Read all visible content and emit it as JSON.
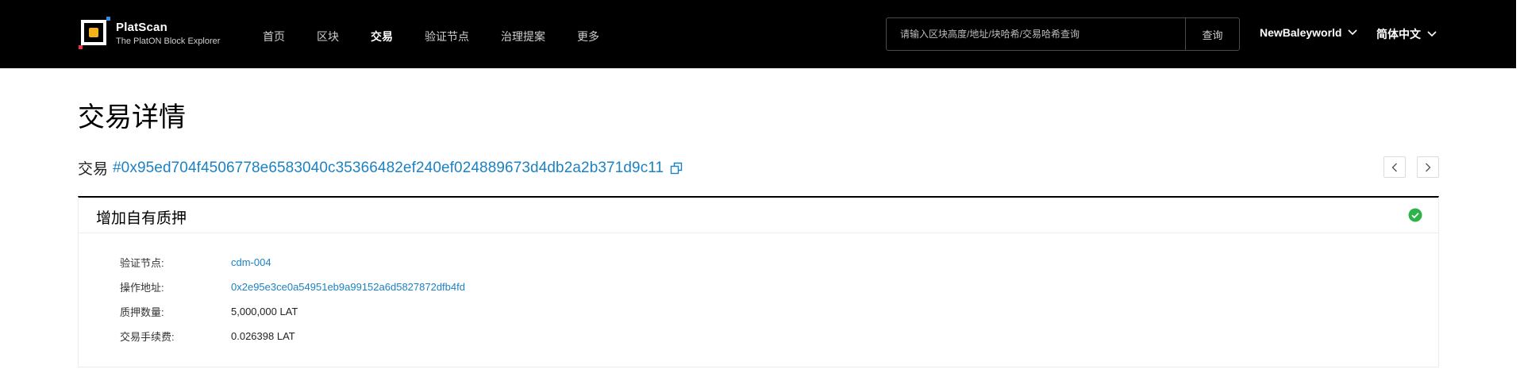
{
  "header": {
    "brand_name": "PlatScan",
    "brand_subtitle": "The PlatON Block Explorer",
    "nav": [
      {
        "label": "首页",
        "active": false
      },
      {
        "label": "区块",
        "active": false
      },
      {
        "label": "交易",
        "active": true
      },
      {
        "label": "验证节点",
        "active": false
      },
      {
        "label": "治理提案",
        "active": false
      },
      {
        "label": "更多",
        "active": false
      }
    ],
    "search": {
      "placeholder": "请输入区块高度/地址/块哈希/交易哈希查询",
      "button_label": "查询"
    },
    "network_selector": "NewBaleyworld",
    "language_selector": "简体中文"
  },
  "page": {
    "title": "交易详情",
    "tx_prefix": "交易",
    "tx_hash": "#0x95ed704f4506778e6583040c35366482ef240ef024889673d4db2a2b371d9c11"
  },
  "card": {
    "title": "增加自有质押",
    "status": "success",
    "rows": [
      {
        "label": "验证节点:",
        "value": "cdm-004",
        "link": true
      },
      {
        "label": "操作地址:",
        "value": "0x2e95e3ce0a54951eb9a99152a6d5827872dfb4fd",
        "link": true
      },
      {
        "label": "质押数量:",
        "value": "5,000,000 LAT",
        "link": false
      },
      {
        "label": "交易手续费:",
        "value": "0.026398 LAT",
        "link": false
      }
    ]
  },
  "colors": {
    "header_bg": "#000000",
    "link": "#1b82c4",
    "success": "#2db34a",
    "logo_accent_red": "#e5364b",
    "logo_accent_blue": "#2f8de4",
    "logo_core": "#f6b21b"
  },
  "icons": {
    "copy": "copy-icon",
    "prev": "chevron-left-icon",
    "next": "chevron-right-icon",
    "dropdown": "chevron-down-icon",
    "status": "check-circle-icon"
  }
}
